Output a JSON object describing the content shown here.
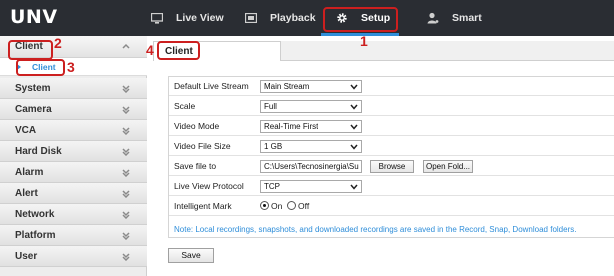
{
  "brand": {
    "logo_text": "UNV"
  },
  "nav": {
    "items": [
      {
        "label": "Live View",
        "icon": "monitor-icon"
      },
      {
        "label": "Playback",
        "icon": "film-icon"
      },
      {
        "label": "Setup",
        "icon": "gear-icon",
        "active": true
      },
      {
        "label": "Smart",
        "icon": "person-icon"
      }
    ]
  },
  "sidebar": {
    "header": "Client",
    "sub_item": "Client",
    "items": [
      "System",
      "Camera",
      "VCA",
      "Hard Disk",
      "Alarm",
      "Alert",
      "Network",
      "Platform",
      "User"
    ]
  },
  "content": {
    "tab": "Client",
    "rows": [
      {
        "label": "Default Live Stream",
        "value": "Main Stream"
      },
      {
        "label": "Scale",
        "value": "Full"
      },
      {
        "label": "Video Mode",
        "value": "Real-Time First"
      },
      {
        "label": "Video File Size",
        "value": "1 GB"
      },
      {
        "label": "Save file to",
        "value": "C:\\Users\\Tecnosinergia\\Su",
        "browse": "Browse",
        "open": "Open Fold..."
      },
      {
        "label": "Live View Protocol",
        "value": "TCP"
      },
      {
        "label": "Intelligent Mark",
        "on": "On",
        "off": "Off",
        "selected": "On"
      }
    ],
    "note": "Note: Local recordings, snapshots, and downloaded recordings are saved in the Record, Snap, Download folders.",
    "save_label": "Save"
  },
  "annotations": [
    "1",
    "2",
    "3",
    "4"
  ],
  "colors": {
    "accent": "#2f8ed9",
    "topbar": "#2a2d33",
    "annotation": "#cc1f1f"
  }
}
